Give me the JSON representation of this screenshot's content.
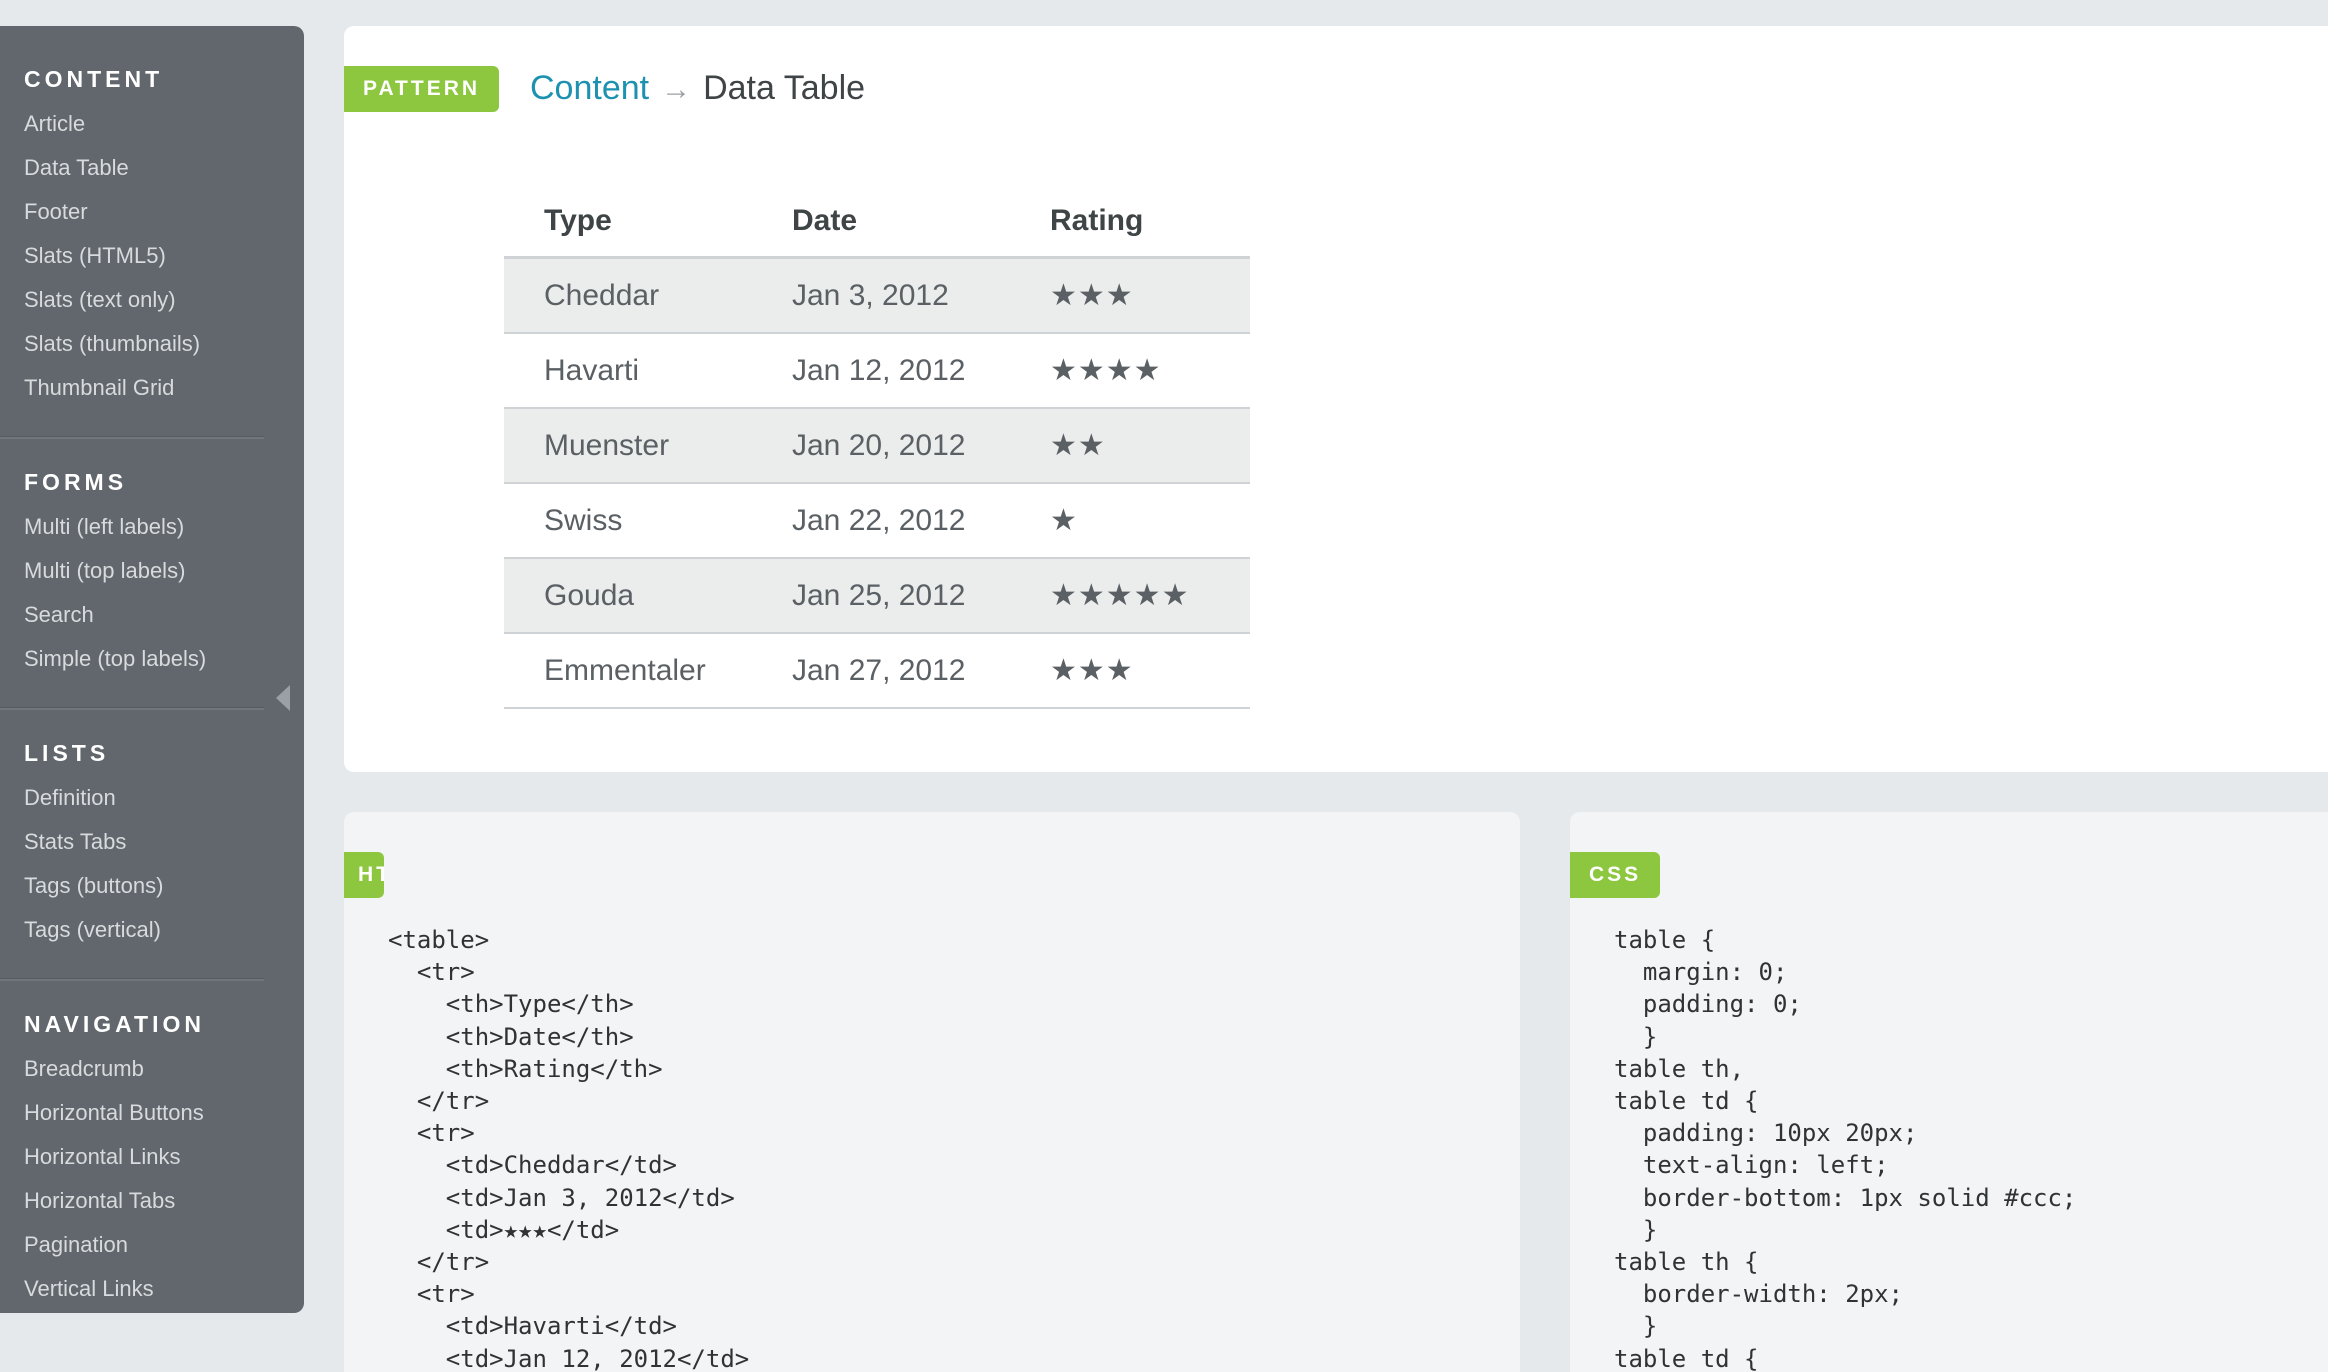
{
  "sidebar": {
    "sections": [
      {
        "heading": "CONTENT",
        "items": [
          "Article",
          "Data Table",
          "Footer",
          "Slats (HTML5)",
          "Slats (text only)",
          "Slats (thumbnails)",
          "Thumbnail Grid"
        ]
      },
      {
        "heading": "FORMS",
        "items": [
          "Multi (left labels)",
          "Multi (top labels)",
          "Search",
          "Simple (top labels)"
        ]
      },
      {
        "heading": "LISTS",
        "items": [
          "Definition",
          "Stats Tabs",
          "Tags (buttons)",
          "Tags (vertical)"
        ]
      },
      {
        "heading": "NAVIGATION",
        "items": [
          "Breadcrumb",
          "Horizontal Buttons",
          "Horizontal Links",
          "Horizontal Tabs",
          "Pagination",
          "Vertical Links"
        ]
      }
    ],
    "collapse_icon": "triangle-left-icon"
  },
  "pattern": {
    "tag": "PATTERN",
    "breadcrumb": {
      "parent": "Content",
      "separator_icon": "arrow-right-icon",
      "separator": "→",
      "current": "Data Table"
    },
    "table": {
      "headers": [
        "Type",
        "Date",
        "Rating"
      ],
      "rows": [
        {
          "type": "Cheddar",
          "date": "Jan 3, 2012",
          "rating": "★★★",
          "stars": 3
        },
        {
          "type": "Havarti",
          "date": "Jan 12, 2012",
          "rating": "★★★★",
          "stars": 4
        },
        {
          "type": "Muenster",
          "date": "Jan 20, 2012",
          "rating": "★★",
          "stars": 2
        },
        {
          "type": "Swiss",
          "date": "Jan 22, 2012",
          "rating": "★",
          "stars": 1
        },
        {
          "type": "Gouda",
          "date": "Jan 25, 2012",
          "rating": "★★★★★",
          "stars": 5
        },
        {
          "type": "Emmentaler",
          "date": "Jan 27, 2012",
          "rating": "★★★",
          "stars": 3
        }
      ]
    }
  },
  "html_panel": {
    "tag": "HTML",
    "code": "<table>\n  <tr>\n    <th>Type</th>\n    <th>Date</th>\n    <th>Rating</th>\n  </tr>\n  <tr>\n    <td>Cheddar</td>\n    <td>Jan 3, 2012</td>\n    <td>★★★</td>\n  </tr>\n  <tr>\n    <td>Havarti</td>\n    <td>Jan 12, 2012</td>"
  },
  "css_panel": {
    "tag": "CSS",
    "code": "table {\n  margin: 0;\n  padding: 0;\n  }\ntable th,\ntable td {\n  padding: 10px 20px;\n  text-align: left;\n  border-bottom: 1px solid #ccc;\n  }\ntable th {\n  border-width: 2px;\n  }\ntable td {"
  },
  "colors": {
    "accent_green": "#8dc63f",
    "link_blue": "#1d91b0",
    "sidebar_bg": "#61676c"
  }
}
